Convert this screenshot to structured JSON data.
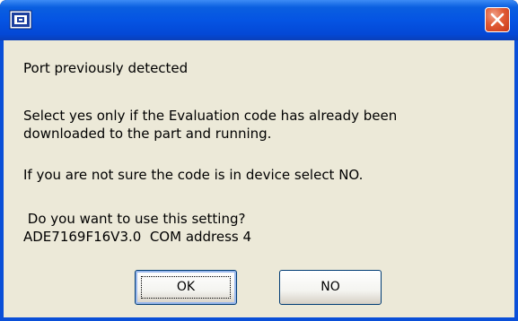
{
  "dialog": {
    "title": "",
    "icon": "app-window-icon",
    "close_icon": "close-icon",
    "messages": [
      "Port previously detected",
      "Select yes only if the Evaluation code has already been\ndownloaded to the part and running.",
      "If you are not sure the code is in device select NO.",
      " Do you want to use this setting?\nADE7169F16V3.0  COM address 4"
    ],
    "buttons": {
      "ok_label": "OK",
      "no_label": "NO"
    }
  },
  "colors": {
    "titlebar": "#0554e3",
    "client": "#ece9d8",
    "close_button": "#e05b34",
    "button_border": "#003c74"
  }
}
